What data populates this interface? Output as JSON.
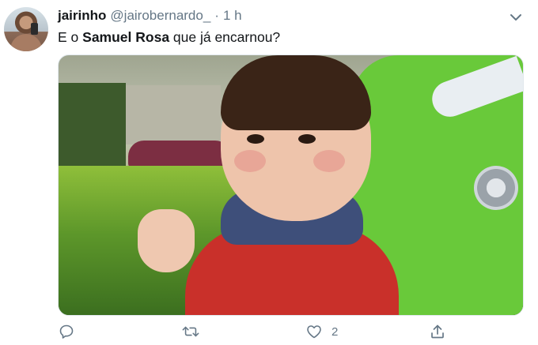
{
  "tweet": {
    "author_name": "jairinho",
    "author_handle": "@jairobernardo_",
    "separator": "·",
    "time": "1 h",
    "text_before": "E o ",
    "text_bold": "Samuel Rosa",
    "text_after": " que já encarnou?",
    "like_count": "2"
  },
  "icons": {
    "menu": "chevron-down-icon",
    "reply": "reply-icon",
    "retweet": "retweet-icon",
    "like": "heart-icon",
    "share": "share-icon"
  },
  "colors": {
    "text": "#14171a",
    "muted": "#657786",
    "border": "#e1e8ed"
  }
}
